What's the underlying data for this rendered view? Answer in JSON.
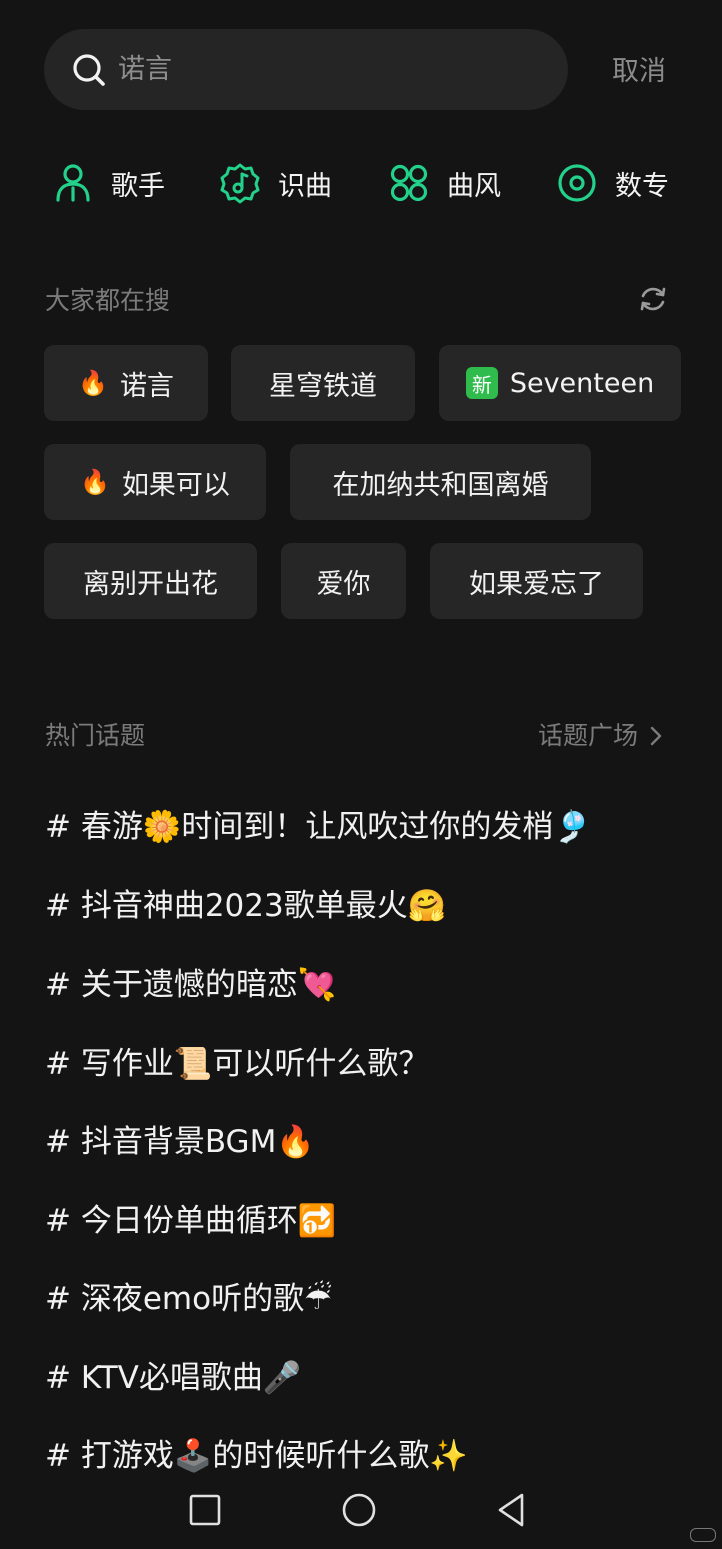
{
  "search": {
    "placeholder": "诺言",
    "cancel_label": "取消"
  },
  "categories": [
    {
      "label": "歌手",
      "icon": "singer-icon"
    },
    {
      "label": "识曲",
      "icon": "music-recognize-icon"
    },
    {
      "label": "曲风",
      "icon": "genre-grid-icon"
    },
    {
      "label": "数专",
      "icon": "digital-album-icon"
    }
  ],
  "trending": {
    "title": "大家都在搜",
    "chips": [
      {
        "label": "诺言",
        "badge": "fire"
      },
      {
        "label": "星穹铁道"
      },
      {
        "label": "Seventeen",
        "badge": "new",
        "badge_text": "新"
      },
      {
        "label": "如果可以",
        "badge": "fire"
      },
      {
        "label": "在加纳共和国离婚"
      },
      {
        "label": "离别开出花"
      },
      {
        "label": "爱你"
      },
      {
        "label": "如果爱忘了"
      }
    ]
  },
  "hot_topics": {
    "title": "热门话题",
    "link_label": "话题广场",
    "items": [
      "# 春游🌼时间到！让风吹过你的发梢🎐",
      "# 抖音神曲2023歌单最火🤗",
      "# 关于遗憾的暗恋💘",
      "# 写作业📜可以听什么歌？",
      "# 抖音背景BGM🔥",
      "# 今日份单曲循环🔂",
      "# 深夜emo听的歌☔",
      "# KTV必唱歌曲🎤",
      "# 打游戏🕹️的时候听什么歌✨"
    ]
  },
  "colors": {
    "accent": "#23d18b",
    "background": "#141414",
    "chip_bg": "#262626"
  },
  "watermark": "小红书"
}
